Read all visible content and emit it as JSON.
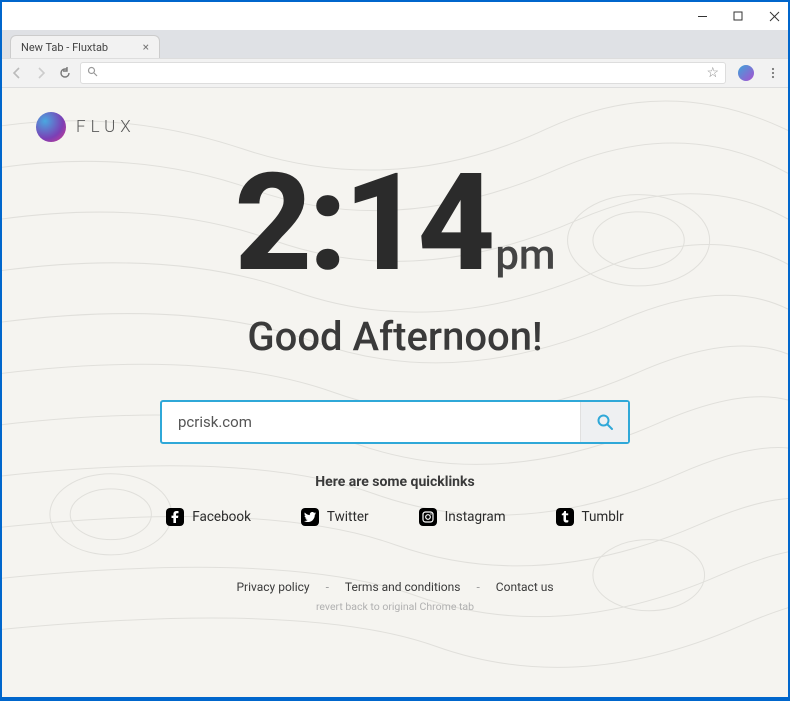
{
  "window": {
    "tab_title": "New Tab - Fluxtab"
  },
  "brand": {
    "name": "FLUX"
  },
  "clock": {
    "time": "2:14",
    "ampm": "pm"
  },
  "greeting": "Good Afternoon!",
  "search": {
    "value": "pcrisk.com"
  },
  "quicklinks": {
    "heading": "Here are some quicklinks",
    "items": [
      {
        "label": "Facebook",
        "icon": "f"
      },
      {
        "label": "Twitter",
        "icon": "t"
      },
      {
        "label": "Instagram",
        "icon": "i"
      },
      {
        "label": "Tumblr",
        "icon": "t"
      }
    ]
  },
  "footer": {
    "privacy": "Privacy policy",
    "terms": "Terms and conditions",
    "contact": "Contact us",
    "revert": "revert back to original Chrome tab"
  }
}
